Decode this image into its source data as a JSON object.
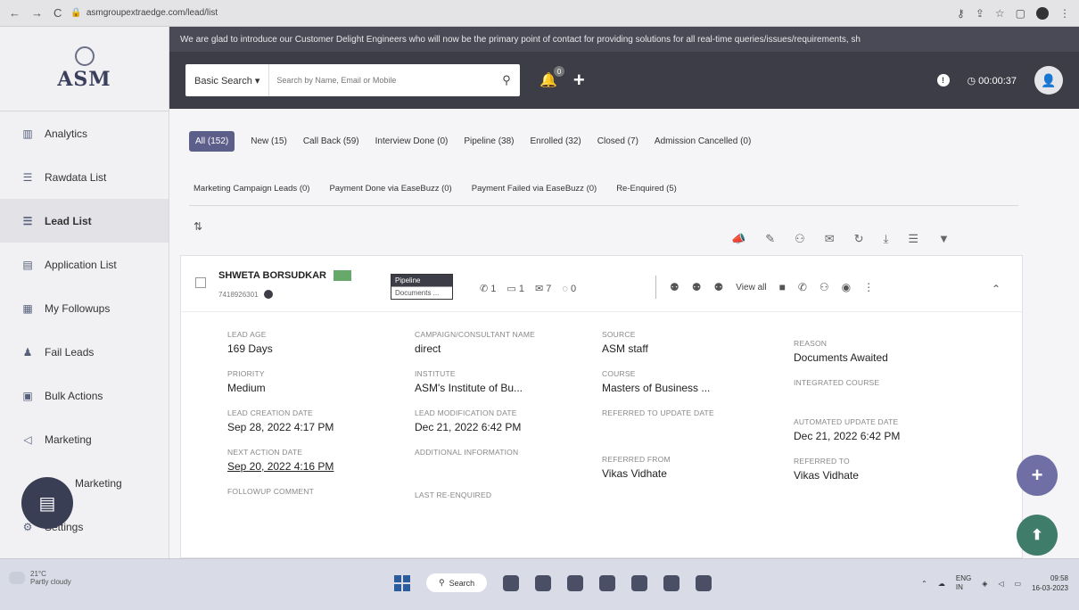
{
  "browser": {
    "url": "asmgroupextraedge.com/lead/list",
    "nav": [
      "←",
      "→",
      "C"
    ]
  },
  "sidebar": {
    "logo": "ASM",
    "items": [
      {
        "label": "Analytics",
        "icon": "analytics-icon",
        "glyph": "▥"
      },
      {
        "label": "Rawdata List",
        "icon": "list-icon",
        "glyph": "☰"
      },
      {
        "label": "Lead List",
        "icon": "list-icon",
        "glyph": "☰"
      },
      {
        "label": "Application List",
        "icon": "document-icon",
        "glyph": "▤"
      },
      {
        "label": "My Followups",
        "icon": "calendar-icon",
        "glyph": "▦"
      },
      {
        "label": "Fail Leads",
        "icon": "user-icon",
        "glyph": "♟"
      },
      {
        "label": "Bulk Actions",
        "icon": "bulk-icon",
        "glyph": "▣"
      },
      {
        "label": "Marketing",
        "icon": "megaphone-icon",
        "glyph": "◁"
      },
      {
        "label": "Marketing",
        "icon": "megaphone-icon",
        "glyph": ""
      },
      {
        "label": "Settings",
        "icon": "gear-icon",
        "glyph": "⚙"
      }
    ]
  },
  "announcement": "We are glad to introduce our Customer Delight Engineers who will now be the primary point of contact for providing solutions for all real-time queries/issues/requirements, sh",
  "header": {
    "search_type": "Basic Search ▾",
    "search_placeholder": "Search by Name, Email or Mobile",
    "bell_badge": "0",
    "timer": "00:00:37"
  },
  "tabs_row1": [
    "All (152)",
    "New (15)",
    "Call Back (59)",
    "Interview Done (0)",
    "Pipeline (38)",
    "Enrolled (32)",
    "Closed (7)",
    "Admission Cancelled (0)"
  ],
  "tabs_row2": [
    "Marketing Campaign Leads (0)",
    "Payment Done via EaseBuzz (0)",
    "Payment Failed via EaseBuzz (0)",
    "Re-Enquired (5)"
  ],
  "lead": {
    "name": "SHWETA BORSUDKAR",
    "phone": "7418926301",
    "stage": "Pipeline",
    "sub_stage": "Documents ...",
    "counts": {
      "calls": "1",
      "comments": "1",
      "emails": "7",
      "whatsapp": "0"
    },
    "view_all": "View all",
    "fields": [
      {
        "label": "LEAD AGE",
        "value": "169 Days"
      },
      {
        "label": "PRIORITY",
        "value": "Medium"
      },
      {
        "label": "LEAD CREATION DATE",
        "value": "Sep 28, 2022 4:17 PM"
      },
      {
        "label": "NEXT ACTION DATE",
        "value": "Sep 20, 2022 4:16 PM"
      },
      {
        "label": "FOLLOWUP COMMENT",
        "value": ""
      },
      {
        "label": "CAMPAIGN/CONSULTANT NAME",
        "value": "direct"
      },
      {
        "label": "INSTITUTE",
        "value": "ASM's Institute of Bu..."
      },
      {
        "label": "LEAD MODIFICATION DATE",
        "value": "Dec 21, 2022 6:42 PM"
      },
      {
        "label": "ADDITIONAL INFORMATION",
        "value": ""
      },
      {
        "label": "LAST RE-ENQUIRED",
        "value": ""
      },
      {
        "label": "SOURCE",
        "value": "ASM staff"
      },
      {
        "label": "COURSE",
        "value": "Masters of Business ..."
      },
      {
        "label": "REFERRED TO UPDATE DATE",
        "value": ""
      },
      {
        "label": "REFERRED FROM",
        "value": "Vikas Vidhate"
      },
      {
        "label": "REASON",
        "value": "Documents Awaited"
      },
      {
        "label": "INTEGRATED COURSE",
        "value": ""
      },
      {
        "label": "AUTOMATED UPDATE DATE",
        "value": "Dec 21, 2022 6:42 PM"
      },
      {
        "label": "REFERRED TO",
        "value": "Vikas Vidhate"
      }
    ]
  },
  "taskbar": {
    "temp": "21°C",
    "weather": "Partly cloudy",
    "search": "Search",
    "lang": "ENG",
    "lang2": "IN",
    "time": "09:58",
    "date": "16-03-2023"
  },
  "colors": {
    "accent": "#5c5f8a",
    "header": "#3d3d48",
    "fab_add": "#6f6fa6",
    "fab_up": "#3f7d6a"
  }
}
